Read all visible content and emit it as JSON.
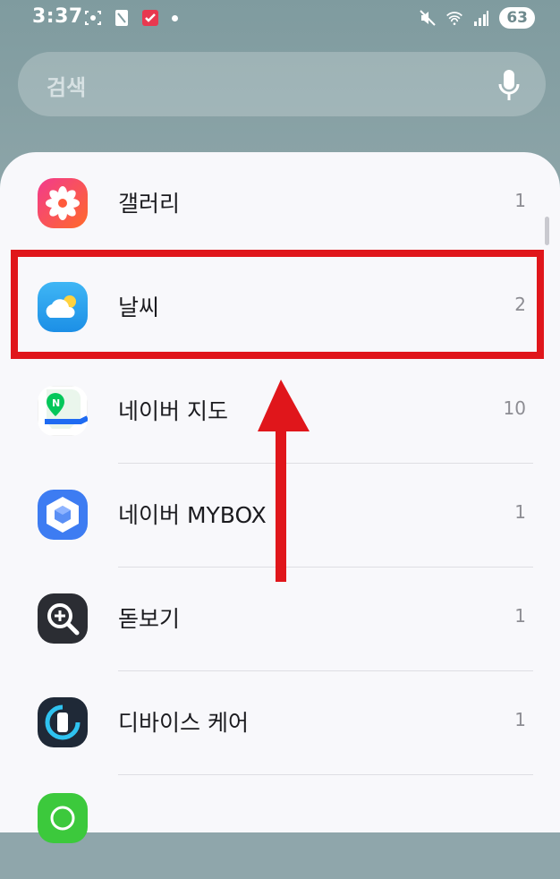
{
  "status": {
    "time": "3:37",
    "battery": "63"
  },
  "search": {
    "placeholder": "검색"
  },
  "apps": [
    {
      "name": "갤러리",
      "count": "1",
      "icon": "gallery-icon"
    },
    {
      "name": "날씨",
      "count": "2",
      "icon": "weather-icon"
    },
    {
      "name": "네이버 지도",
      "count": "10",
      "icon": "naver-map-icon"
    },
    {
      "name": "네이버 MYBOX",
      "count": "1",
      "icon": "naver-mybox-icon"
    },
    {
      "name": "돋보기",
      "count": "1",
      "icon": "magnifier-icon"
    },
    {
      "name": "디바이스 케어",
      "count": "1",
      "icon": "device-care-icon"
    }
  ],
  "colors": {
    "highlight": "#e0161b",
    "background": "#7f9b9f",
    "sheet": "#f8f8fb"
  }
}
